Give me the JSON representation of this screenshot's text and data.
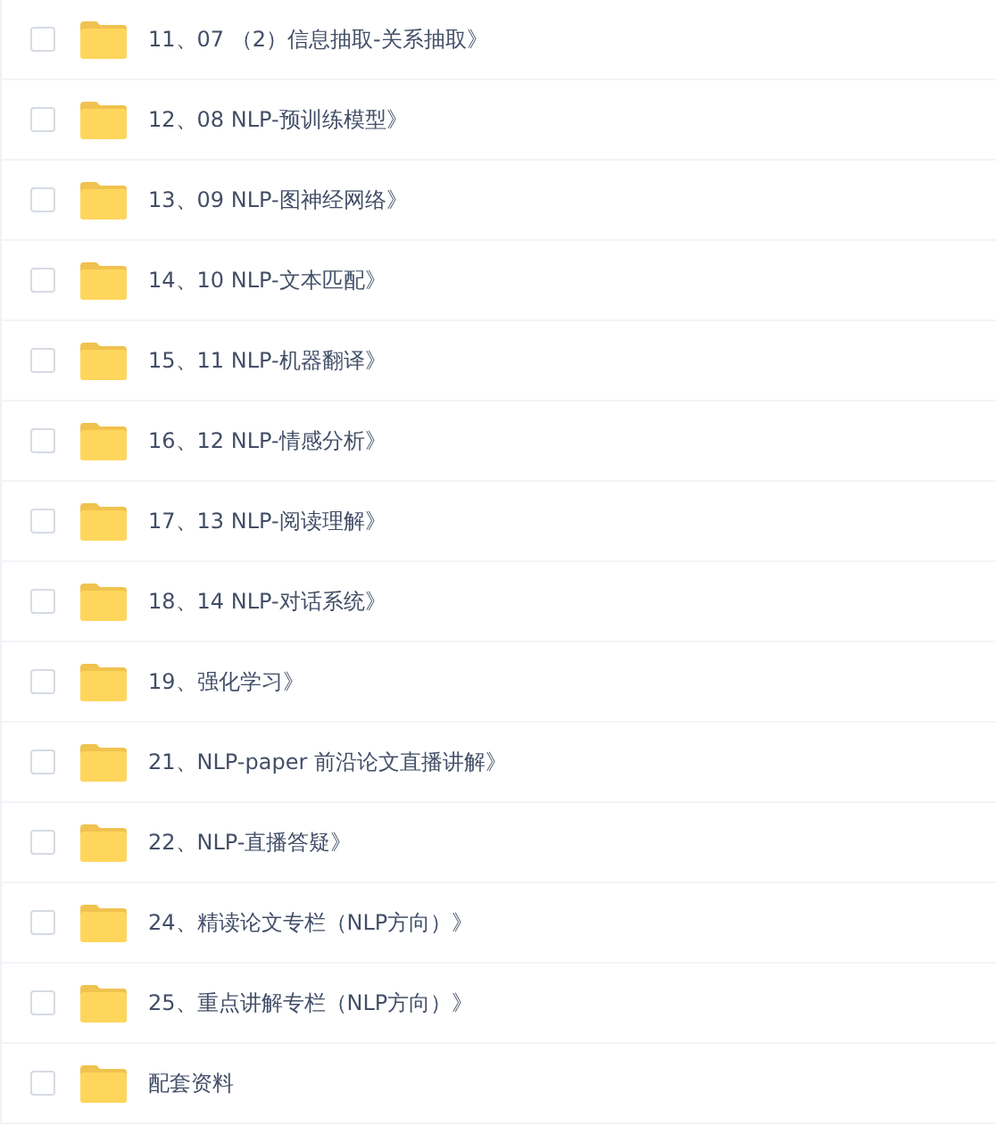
{
  "files": [
    {
      "name": "11、07 （2）信息抽取-关系抽取》",
      "checked": false
    },
    {
      "name": "12、08 NLP-预训练模型》",
      "checked": false
    },
    {
      "name": "13、09 NLP-图神经网络》",
      "checked": false
    },
    {
      "name": "14、10 NLP-文本匹配》",
      "checked": false
    },
    {
      "name": "15、11 NLP-机器翻译》",
      "checked": false
    },
    {
      "name": "16、12 NLP-情感分析》",
      "checked": false
    },
    {
      "name": "17、13 NLP-阅读理解》",
      "checked": false
    },
    {
      "name": "18、14 NLP-对话系统》",
      "checked": false
    },
    {
      "name": "19、强化学习》",
      "checked": false
    },
    {
      "name": "21、NLP-paper 前沿论文直播讲解》",
      "checked": false
    },
    {
      "name": "22、NLP-直播答疑》",
      "checked": false
    },
    {
      "name": "24、精读论文专栏（NLP方向）》",
      "checked": false
    },
    {
      "name": "25、重点讲解专栏（NLP方向）》",
      "checked": false
    },
    {
      "name": "配套资料",
      "checked": false
    }
  ]
}
